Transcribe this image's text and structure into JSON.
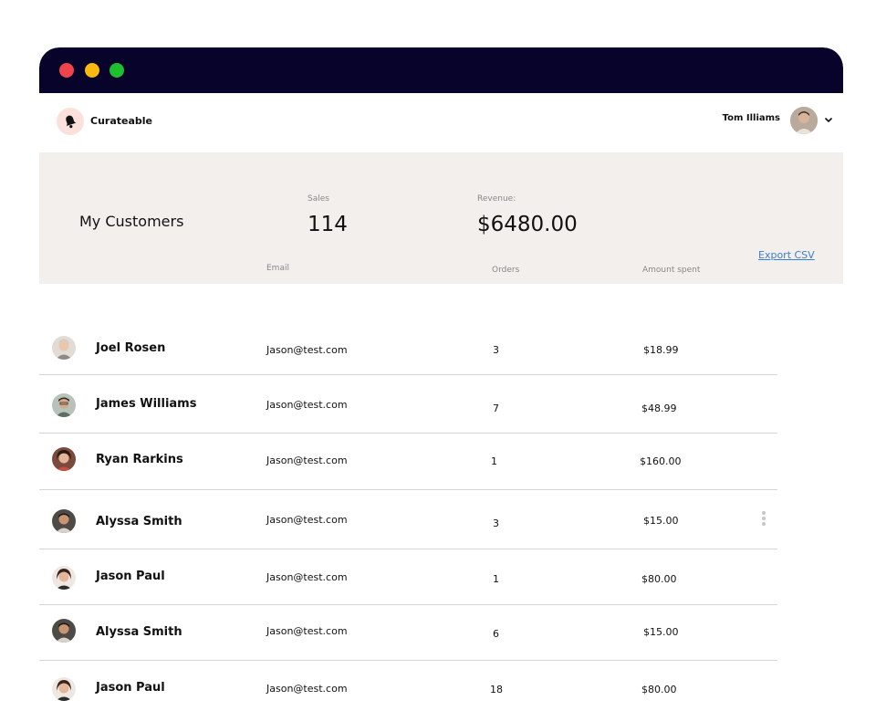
{
  "window": {
    "controls": [
      "close",
      "minimize",
      "maximize"
    ],
    "control_colors": [
      "#f0444d",
      "#f9b90e",
      "#1ec02f"
    ]
  },
  "topbar": {
    "brand": "Curateable",
    "logo_icon": "bell-icon",
    "user_name": "Tom Illiams",
    "caret_icon": "chevron-down-icon"
  },
  "summary": {
    "title": "My Customers",
    "sales_label": "Sales",
    "sales_value": "114",
    "revenue_label": "Revenue:",
    "revenue_value": "$6480.00",
    "export_label": "Export CSV"
  },
  "table": {
    "headers": {
      "email": "Email",
      "orders": "Orders",
      "amount": "Amount spent"
    },
    "rows": [
      {
        "name": "Joel Rosen",
        "email": "Jason@test.com",
        "orders": "3",
        "amount": "$18.99"
      },
      {
        "name": "James Williams",
        "email": "Jason@test.com",
        "orders": "7",
        "amount": "$48.99"
      },
      {
        "name": "Ryan Rarkins",
        "email": "Jason@test.com",
        "orders": "1",
        "amount": "$160.00"
      },
      {
        "name": "Alyssa Smith",
        "email": "Jason@test.com",
        "orders": "3",
        "amount": "$15.00"
      },
      {
        "name": "Jason Paul",
        "email": "Jason@test.com",
        "orders": "1",
        "amount": "$80.00"
      },
      {
        "name": "Alyssa Smith",
        "email": "Jason@test.com",
        "orders": "6",
        "amount": "$15.00"
      },
      {
        "name": "Jason Paul",
        "email": "Jason@test.com",
        "orders": "18",
        "amount": "$80.00"
      }
    ],
    "row_menu_icon": "more-vertical-icon"
  },
  "colors": {
    "titlebar": "#07032b",
    "summary_bg": "#f3efec",
    "link": "#3b7fd0",
    "logo_bg": "#fbe1dc"
  }
}
